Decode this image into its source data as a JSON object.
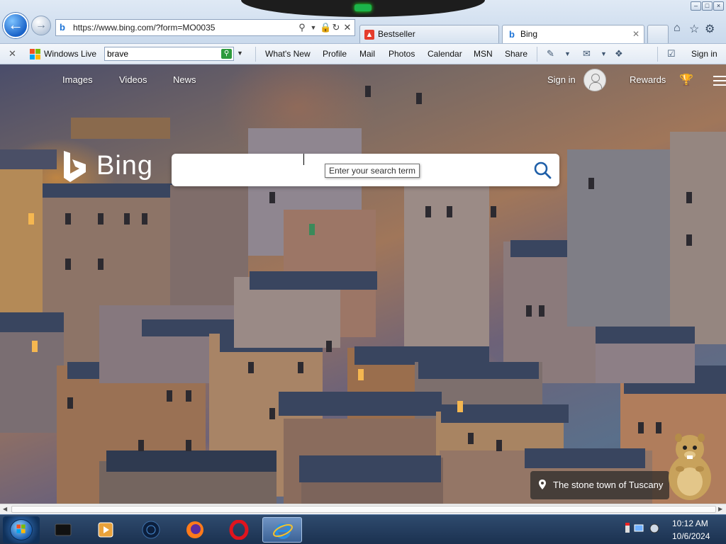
{
  "window": {
    "controls": [
      "minimize",
      "maximize",
      "close"
    ]
  },
  "address_bar": {
    "url": "https://www.bing.com/?form=MO0035"
  },
  "tabs": [
    {
      "label": "Bestseller",
      "icon": "bestseller-tab-icon"
    },
    {
      "label": "Bing",
      "icon": "bing-tab-icon",
      "active": true
    }
  ],
  "command_bar": {
    "windows_live_label": "Windows Live",
    "search_value": "brave",
    "links": [
      "What's New",
      "Profile",
      "Mail",
      "Photos",
      "Calendar",
      "MSN",
      "Share"
    ],
    "sign_in": "Sign in"
  },
  "bing": {
    "nav": [
      "Images",
      "Videos",
      "News"
    ],
    "sign_in": "Sign in",
    "rewards": "Rewards",
    "logo_text": "Bing",
    "search_placeholder": "",
    "tooltip": "Enter your search term",
    "caption": "The stone town of Tuscany"
  },
  "taskbar": {
    "time": "10:12 AM",
    "date": "10/6/2024"
  },
  "colors": {
    "ie_frame": "#c9d9ec",
    "bing_blue": "#0c8ce9",
    "taskbar": "#1b3150"
  }
}
